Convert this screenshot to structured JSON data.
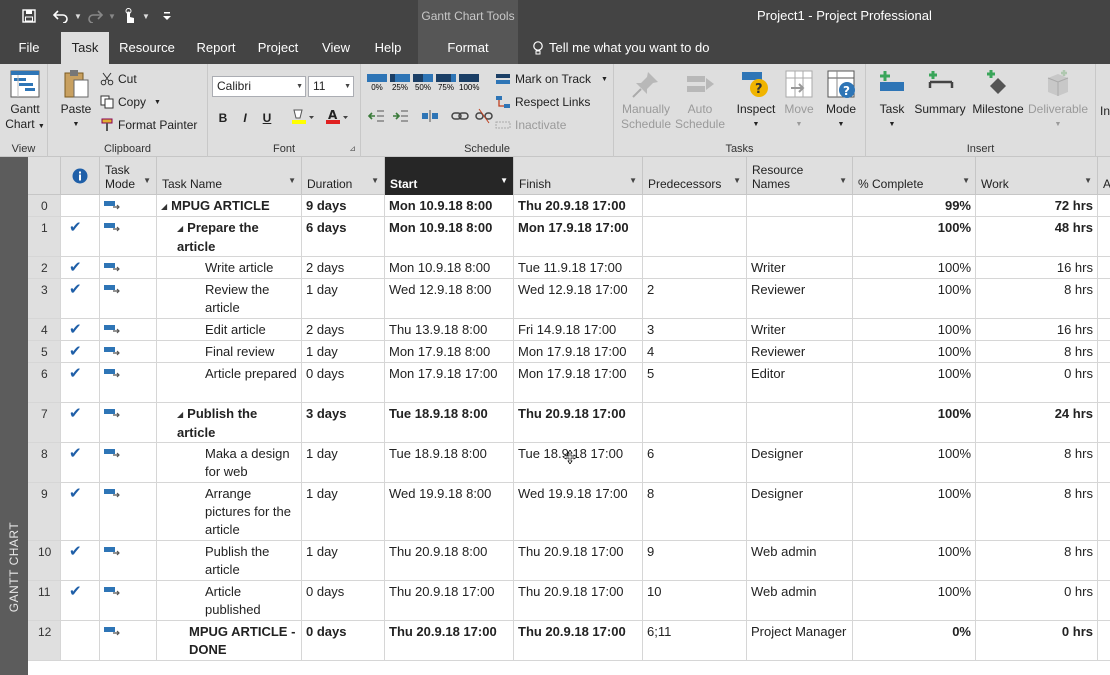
{
  "window": {
    "context_title": "Gantt Chart Tools",
    "title": "Project1  -  Project Professional"
  },
  "tabs": [
    {
      "label": "File",
      "active": false
    },
    {
      "label": "Task",
      "active": true
    },
    {
      "label": "Resource",
      "active": false
    },
    {
      "label": "Report",
      "active": false
    },
    {
      "label": "Project",
      "active": false
    },
    {
      "label": "View",
      "active": false
    },
    {
      "label": "Help",
      "active": false
    },
    {
      "label": "Format",
      "active": false
    },
    {
      "label": "Tell me what you want to do",
      "active": false
    }
  ],
  "ribbon": {
    "view": {
      "label": "View",
      "gantt_chart": "Gantt",
      "gantt_chart_2": "Chart"
    },
    "clipboard": {
      "label": "Clipboard",
      "paste": "Paste",
      "cut": "Cut",
      "copy": "Copy",
      "format_painter": "Format Painter"
    },
    "font": {
      "label": "Font",
      "font_name": "Calibri",
      "font_size": "11",
      "bold": "B",
      "italic": "I",
      "underline": "U"
    },
    "schedule": {
      "label": "Schedule",
      "pct0": "0%",
      "pct25": "25%",
      "pct50": "50%",
      "pct75": "75%",
      "pct100": "100%",
      "mark_on_track": "Mark on Track",
      "respect_links": "Respect Links",
      "inactivate": "Inactivate"
    },
    "tasks": {
      "label": "Tasks",
      "manually": "Manually",
      "manually_2": "Schedule",
      "auto": "Auto",
      "auto_2": "Schedule",
      "inspect": "Inspect",
      "move": "Move",
      "mode": "Mode"
    },
    "insert": {
      "label": "Insert",
      "task": "Task",
      "summary": "Summary",
      "milestone": "Milestone",
      "deliverable": "Deliverable"
    }
  },
  "sidebar_label": "GANTT CHART",
  "columns": {
    "task_mode": "Task Mode",
    "task_name": "Task Name",
    "duration": "Duration",
    "start": "Start",
    "finish": "Finish",
    "predecessors": "Predecessors",
    "resource_names": "Resource Names",
    "pct_complete": "% Complete",
    "work": "Work"
  },
  "rows": [
    {
      "id": "0",
      "done": false,
      "level": 0,
      "summary": true,
      "name": "MPUG ARTICLE",
      "duration": "9 days",
      "start": "Mon 10.9.18 8:00",
      "finish": "Thu 20.9.18 17:00",
      "pred": "",
      "res": "",
      "pct": "99%",
      "work": "72 hrs"
    },
    {
      "id": "1",
      "done": true,
      "level": 1,
      "summary": true,
      "name": "Prepare the article",
      "duration": "6 days",
      "start": "Mon 10.9.18 8:00",
      "finish": "Mon 17.9.18 17:00",
      "pred": "",
      "res": "",
      "pct": "100%",
      "work": "48 hrs"
    },
    {
      "id": "2",
      "done": true,
      "level": 2,
      "summary": false,
      "name": "Write article",
      "duration": "2 days",
      "start": "Mon 10.9.18 8:00",
      "finish": "Tue 11.9.18 17:00",
      "pred": "",
      "res": "Writer",
      "pct": "100%",
      "work": "16 hrs"
    },
    {
      "id": "3",
      "done": true,
      "level": 2,
      "summary": false,
      "name": "Review the article",
      "duration": "1 day",
      "start": "Wed 12.9.18 8:00",
      "finish": "Wed 12.9.18 17:00",
      "pred": "2",
      "res": "Reviewer",
      "pct": "100%",
      "work": "8 hrs"
    },
    {
      "id": "4",
      "done": true,
      "level": 2,
      "summary": false,
      "name": "Edit article",
      "duration": "2 days",
      "start": "Thu 13.9.18 8:00",
      "finish": "Fri 14.9.18 17:00",
      "pred": "3",
      "res": "Writer",
      "pct": "100%",
      "work": "16 hrs"
    },
    {
      "id": "5",
      "done": true,
      "level": 2,
      "summary": false,
      "name": "Final review",
      "duration": "1 day",
      "start": "Mon 17.9.18 8:00",
      "finish": "Mon 17.9.18 17:00",
      "pred": "4",
      "res": "Reviewer",
      "pct": "100%",
      "work": "8 hrs"
    },
    {
      "id": "6",
      "done": true,
      "level": 2,
      "summary": false,
      "name": "Article prepared",
      "duration": "0 days",
      "start": "Mon 17.9.18 17:00",
      "finish": "Mon 17.9.18 17:00",
      "pred": "5",
      "res": "Editor",
      "pct": "100%",
      "work": "0 hrs"
    },
    {
      "id": "7",
      "done": true,
      "level": 1,
      "summary": true,
      "name": "Publish the article",
      "duration": "3 days",
      "start": "Tue 18.9.18 8:00",
      "finish": "Thu 20.9.18 17:00",
      "pred": "",
      "res": "",
      "pct": "100%",
      "work": "24 hrs"
    },
    {
      "id": "8",
      "done": true,
      "level": 2,
      "summary": false,
      "name": "Maka a design for web",
      "duration": "1 day",
      "start": "Tue 18.9.18 8:00",
      "finish": "Tue 18.9.18 17:00",
      "pred": "6",
      "res": "Designer",
      "pct": "100%",
      "work": "8 hrs"
    },
    {
      "id": "9",
      "done": true,
      "level": 2,
      "summary": false,
      "name": "Arrange pictures for the article",
      "duration": "1 day",
      "start": "Wed 19.9.18 8:00",
      "finish": "Wed 19.9.18 17:00",
      "pred": "8",
      "res": "Designer",
      "pct": "100%",
      "work": "8 hrs"
    },
    {
      "id": "10",
      "done": true,
      "level": 2,
      "summary": false,
      "name": "Publish the article",
      "duration": "1 day",
      "start": "Thu 20.9.18 8:00",
      "finish": "Thu 20.9.18 17:00",
      "pred": "9",
      "res": "Web admin",
      "pct": "100%",
      "work": "8 hrs"
    },
    {
      "id": "11",
      "done": true,
      "level": 2,
      "summary": false,
      "name": "Article published",
      "duration": "0 days",
      "start": "Thu 20.9.18 17:00",
      "finish": "Thu 20.9.18 17:00",
      "pred": "10",
      "res": "Web admin",
      "pct": "100%",
      "work": "0 hrs"
    },
    {
      "id": "12",
      "done": false,
      "level": 1,
      "summary": false,
      "milestone_bold": true,
      "name": "MPUG ARTICLE - DONE",
      "duration": "0 days",
      "start": "Thu 20.9.18 17:00",
      "finish": "Thu 20.9.18 17:00",
      "pred": "6;11",
      "res": "Project Manager",
      "pct": "0%",
      "work": "0 hrs"
    }
  ],
  "colors": {
    "accent": "#1f5fa8",
    "title_bar": "#444444",
    "ribbon": "#dedede",
    "selected_header": "#262626"
  }
}
